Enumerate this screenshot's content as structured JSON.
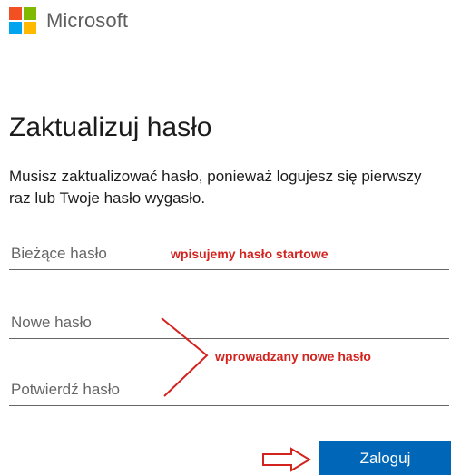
{
  "brand": {
    "name": "Microsoft"
  },
  "colors": {
    "accent": "#0067b8",
    "annotation": "#d2231f"
  },
  "page": {
    "title": "Zaktualizuj hasło",
    "description": "Musisz zaktualizować hasło, ponieważ logujesz się pierwszy raz lub Twoje hasło wygasło."
  },
  "form": {
    "current_password_placeholder": "Bieżące hasło",
    "new_password_placeholder": "Nowe hasło",
    "confirm_password_placeholder": "Potwierdź hasło",
    "submit_label": "Zaloguj"
  },
  "annotations": {
    "current": "wpisujemy hasło startowe",
    "new": "wprowadzany nowe hasło"
  }
}
